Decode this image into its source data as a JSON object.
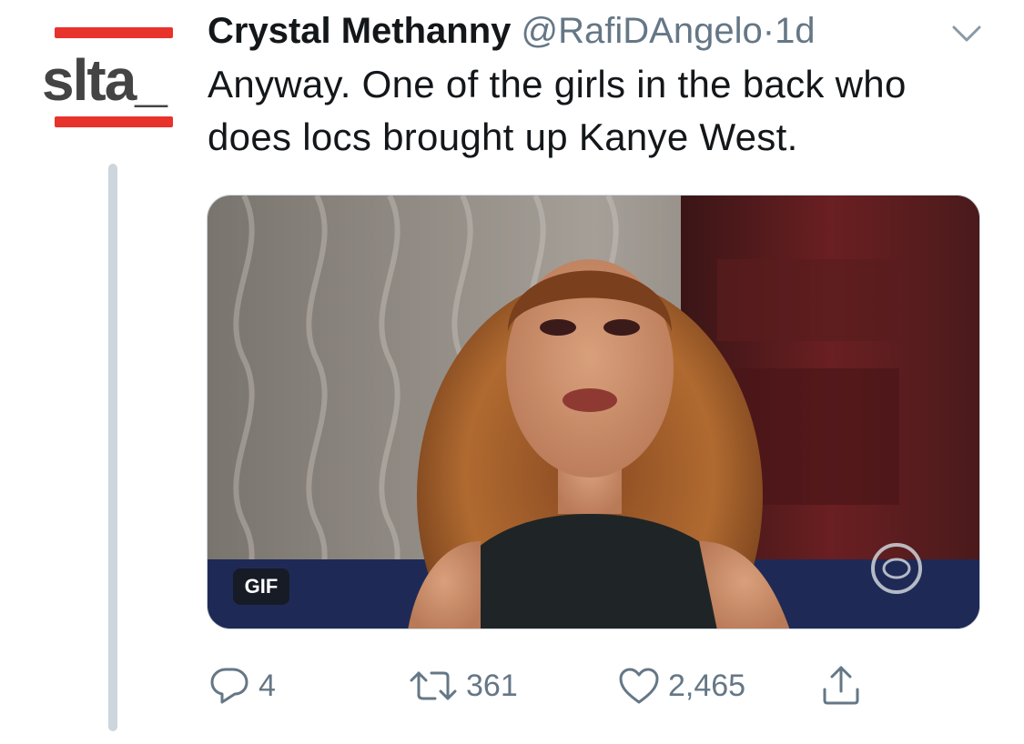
{
  "author": {
    "avatar_text": "slta_",
    "name": "Crystal Methanny",
    "handle": "@RafiDAngelo",
    "separator": "·",
    "time": "1d"
  },
  "tweet": {
    "text": "Anyway. One of the girls in the back who does locs brought up Kanye West."
  },
  "media": {
    "type": "gif",
    "badge": "GIF"
  },
  "actions": {
    "reply": {
      "icon": "reply-icon",
      "count": "4"
    },
    "retweet": {
      "icon": "retweet-icon",
      "count": "361"
    },
    "like": {
      "icon": "heart-icon",
      "count": "2,465"
    },
    "share": {
      "icon": "share-icon"
    }
  },
  "colors": {
    "text": "#14171a",
    "secondary": "#657786",
    "logo_red": "#e8322c",
    "thread_line": "#cdd6dd"
  }
}
